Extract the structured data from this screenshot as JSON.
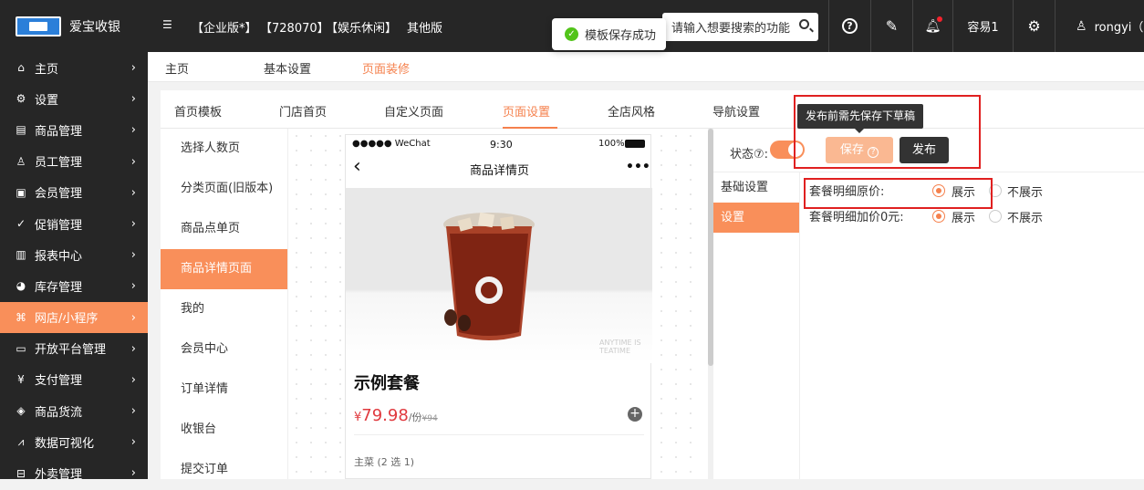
{
  "app": {
    "name": "爱宝收银"
  },
  "topbar": {
    "editions": [
      "【企业版*】",
      "【728070】",
      "【娱乐休闲】",
      "其他版"
    ],
    "search_placeholder": "请输入想要搜索的功能",
    "store": "容易1",
    "user": "rongyi（"
  },
  "toast": {
    "message": "模板保存成功"
  },
  "sidebar": {
    "items": [
      {
        "label": "主页",
        "icon": "home-icon"
      },
      {
        "label": "设置",
        "icon": "gear-icon"
      },
      {
        "label": "商品管理",
        "icon": "barcode-icon"
      },
      {
        "label": "员工管理",
        "icon": "staff-icon"
      },
      {
        "label": "会员管理",
        "icon": "member-card-icon"
      },
      {
        "label": "促销管理",
        "icon": "check-circle-icon"
      },
      {
        "label": "报表中心",
        "icon": "chart-icon"
      },
      {
        "label": "库存管理",
        "icon": "pie-icon"
      },
      {
        "label": "网店/小程序",
        "icon": "shop-icon",
        "active": true
      },
      {
        "label": "开放平台管理",
        "icon": "monitor-icon"
      },
      {
        "label": "支付管理",
        "icon": "yen-icon"
      },
      {
        "label": "商品货流",
        "icon": "cube-icon"
      },
      {
        "label": "数据可视化",
        "icon": "line-chart-icon"
      },
      {
        "label": "外卖管理",
        "icon": "takeout-icon"
      }
    ]
  },
  "subnav": {
    "items": [
      "主页",
      "基本设置",
      "页面装修"
    ],
    "active": "页面装修"
  },
  "tabs": {
    "items": [
      "首页模板",
      "门店首页",
      "自定义页面",
      "页面设置",
      "全店风格",
      "导航设置"
    ],
    "active": "页面设置"
  },
  "pages": {
    "items": [
      "选择人数页",
      "分类页面(旧版本)",
      "商品点单页",
      "商品详情页面",
      "我的",
      "会员中心",
      "订单详情",
      "收银台",
      "提交订单"
    ],
    "active": "商品详情页面"
  },
  "phone": {
    "carrier": "●●●●● WeChat",
    "time": "9:30",
    "battery": "100%",
    "page_title": "商品详情页",
    "more": "•••",
    "product_name": "示例套餐",
    "currency": "¥",
    "price": "79.98",
    "unit": "/份",
    "old_price": "¥94",
    "group_label": "主菜 (2 选 1)",
    "img_caption": "ANYTIME IS TEATIME"
  },
  "settings": {
    "state_label": "状态",
    "save_label": "保存",
    "publish_label": "发布",
    "tooltip": "发布前需先保存下草稿",
    "tabs": [
      "基础设置",
      "设置"
    ],
    "active_tab": "设置",
    "options": [
      {
        "label": "套餐明细原价:",
        "choices": [
          "展示",
          "不展示"
        ],
        "selected": "展示"
      },
      {
        "label": "套餐明细加价0元:",
        "choices": [
          "展示",
          "不展示"
        ],
        "selected": "展示"
      }
    ]
  },
  "colors": {
    "accent": "#f98f5a",
    "accent_text": "#f5814d",
    "topbar": "#262626",
    "price": "#e0393e",
    "annotation": "#e02020"
  }
}
